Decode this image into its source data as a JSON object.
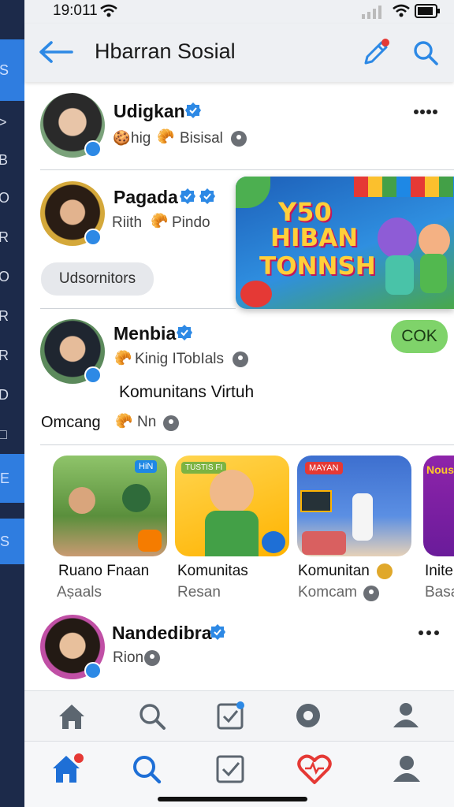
{
  "status_bar": {
    "time": "19:011"
  },
  "header": {
    "title": "Hbarran Sosial"
  },
  "posts": [
    {
      "name": "Udigkan",
      "sub1": "hig",
      "sub2": "Bisisal"
    },
    {
      "name": "Pagada",
      "sub1": "Riith",
      "sub2": "Pindo",
      "chip": "Udsornitors"
    },
    {
      "name": "Menbia",
      "sub1": "Kinig ITobIals",
      "desc": "Komunitans Virtuh",
      "ok_label": "COK",
      "extra_label": "Omcang",
      "extra_sub": "Nn"
    },
    {
      "name": "Nandedibra",
      "sub1": "Rion"
    }
  ],
  "banner": {
    "line1": "Y50",
    "line2": "HIBAN",
    "line3": "TONNSH"
  },
  "cards": [
    {
      "title": "Ruano Fnaan",
      "sub": "Aṣaals",
      "badge": "HiN"
    },
    {
      "title": "Komunitas",
      "sub": "Resan",
      "badge": "TUSTIS FI"
    },
    {
      "title": "Komunitan",
      "sub": "Komcam",
      "badge": "ΜΑΥΑΝ"
    },
    {
      "title": "Inite",
      "sub": "Basa",
      "badge": "Nous"
    }
  ],
  "colors": {
    "accent": "#2d89e5",
    "rail": "#1c2a4a",
    "rail_highlight": "#2f7de0",
    "ok_green": "#7fd36a",
    "heart": "#e53935"
  },
  "icons": [
    "back-arrow-icon",
    "edit-pencil-icon",
    "search-icon",
    "verified-badge-icon",
    "more-icon",
    "home-icon",
    "checklist-icon",
    "settings-icon",
    "profile-icon",
    "heart-icon"
  ]
}
